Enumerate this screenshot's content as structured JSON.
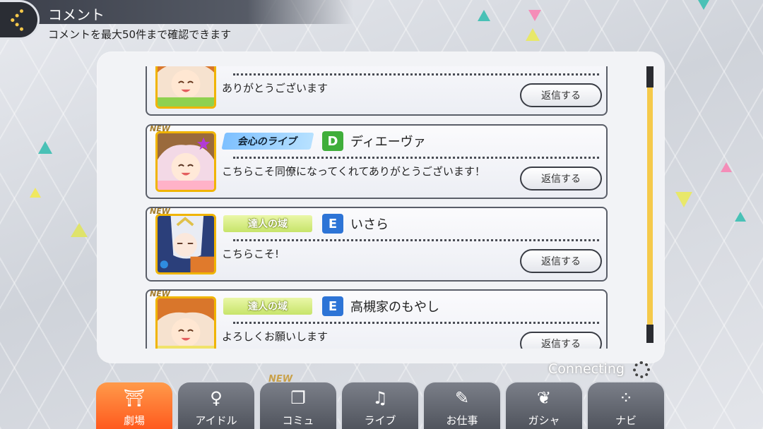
{
  "header": {
    "title": "コメント",
    "subtitle": "コメントを最大50件まで確認できます",
    "back_icon": "chevron-left-icon"
  },
  "comments": [
    {
      "new": false,
      "title": "",
      "rank": "",
      "user": "",
      "text": "ありがとうございます",
      "reply_label": "返信する"
    },
    {
      "new": true,
      "new_label": "NEW",
      "title": "会心のライブ",
      "rank": "D",
      "user": "ディエーヴァ",
      "text": "こちらこそ同僚になってくれてありがとうございます！",
      "reply_label": "返信する"
    },
    {
      "new": true,
      "new_label": "NEW",
      "title": "達人の域",
      "rank": "E",
      "user": "いさら",
      "text": "こちらこそ!",
      "reply_label": "返信する"
    },
    {
      "new": true,
      "new_label": "NEW",
      "title": "達人の域",
      "rank": "E",
      "user": "高槻家のもやし",
      "text": "よろしくお願いします",
      "reply_label": "返信する"
    }
  ],
  "status": {
    "connecting": "Connecting"
  },
  "nav": {
    "items": [
      {
        "label": "劇場",
        "icon": "theater-icon",
        "active": true
      },
      {
        "label": "アイドル",
        "icon": "idol-icon",
        "active": false
      },
      {
        "label": "コミュ",
        "icon": "commu-icon",
        "active": false,
        "new_label": "NEW"
      },
      {
        "label": "ライブ",
        "icon": "music-note-icon",
        "active": false
      },
      {
        "label": "お仕事",
        "icon": "clipboard-icon",
        "active": false
      },
      {
        "label": "ガシャ",
        "icon": "butterfly-icon",
        "active": false
      },
      {
        "label": "ナビ",
        "icon": "grid-dots-icon",
        "active": false
      }
    ]
  },
  "colors": {
    "accent_orange": "#ff5a1e",
    "scroll_yellow": "#f5c94a",
    "rank_d": "#3fae3a",
    "rank_e": "#2d74d6"
  }
}
